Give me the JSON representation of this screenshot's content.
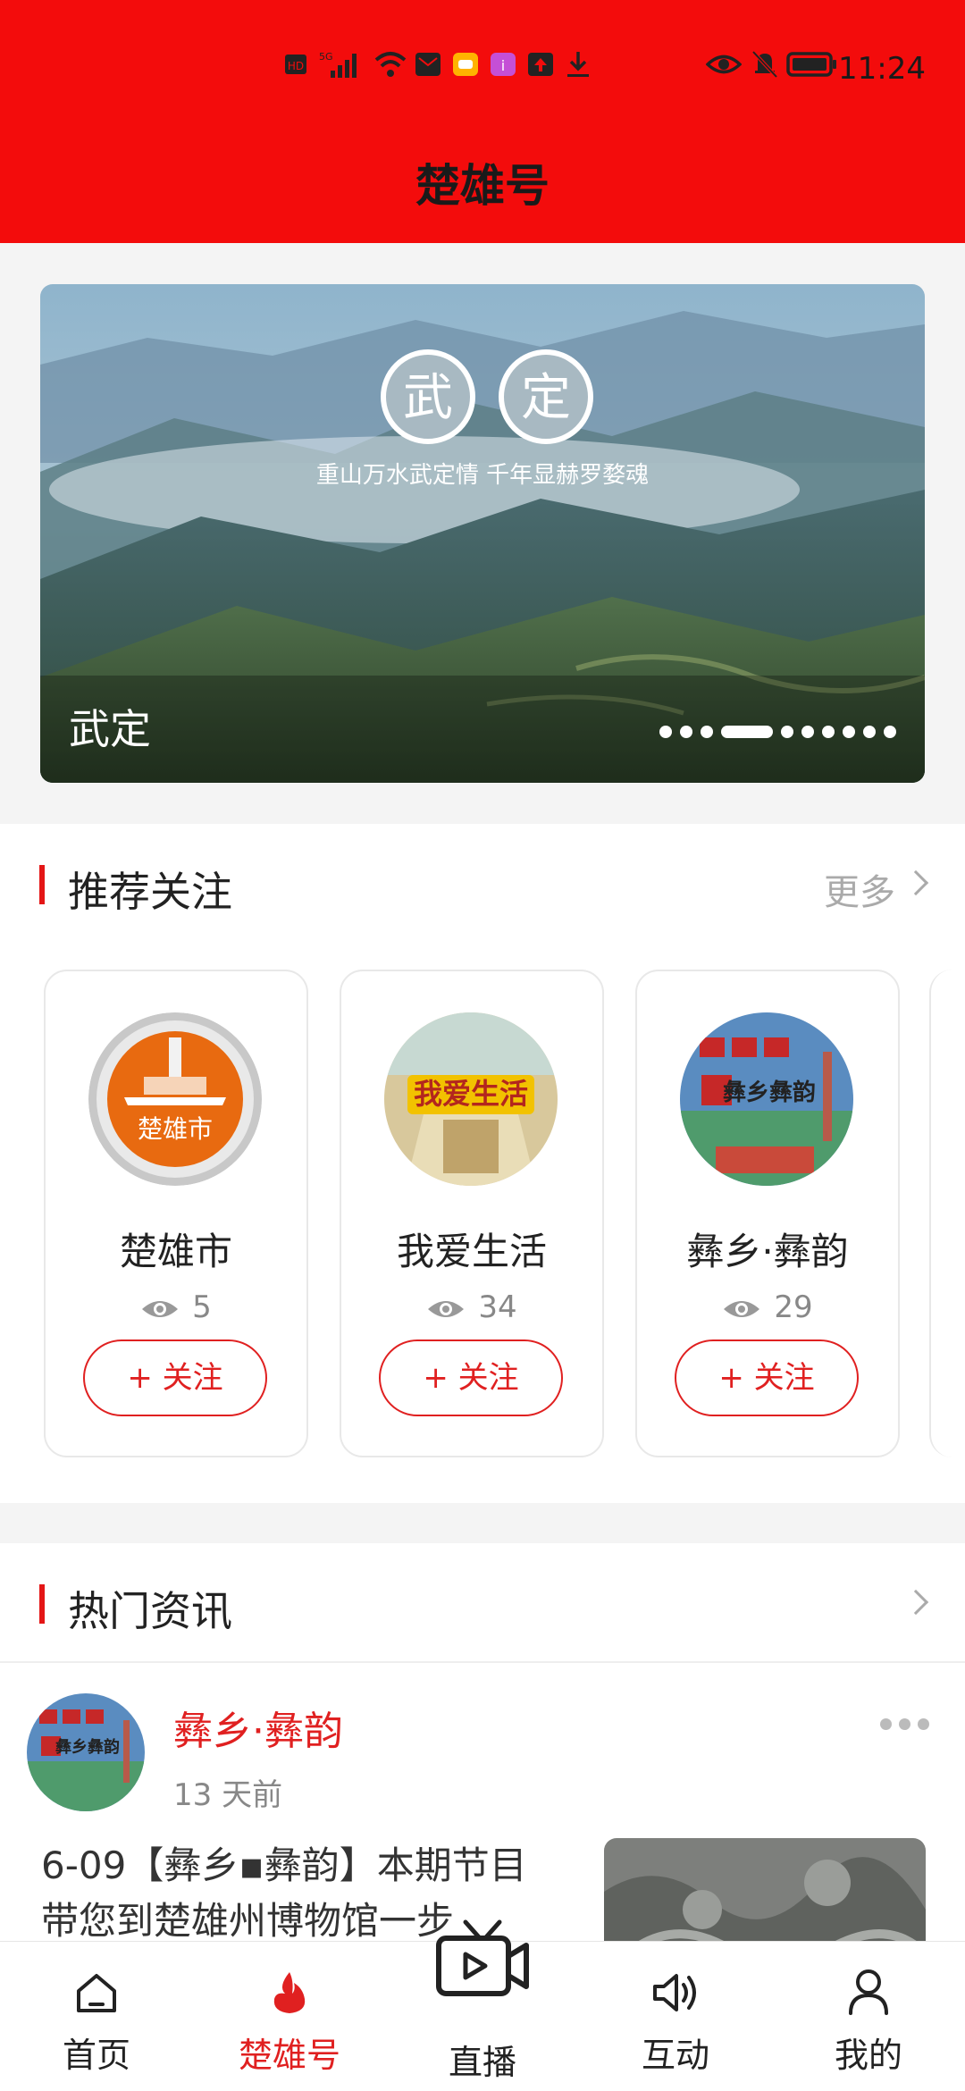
{
  "status_bar": {
    "left_badges": [
      "HD",
      "5G"
    ],
    "time": "11:24"
  },
  "header": {
    "title": "楚雄号"
  },
  "banner": {
    "seal_chars": [
      "武",
      "定"
    ],
    "slogan": "重山万水武定情 千年显赫罗婺魂",
    "caption": "武定",
    "pages": 10,
    "active_page": 3
  },
  "recommend": {
    "title": "推荐关注",
    "more_label": "更多",
    "cards": [
      {
        "name": "楚雄市",
        "views": "5",
        "follow_label": "+  关注",
        "avatar_text": "楚雄市"
      },
      {
        "name": "我爱生活",
        "views": "34",
        "follow_label": "+  关注",
        "avatar_text": "我爱生活"
      },
      {
        "name": "彝乡·彝韵",
        "views": "29",
        "follow_label": "+  关注",
        "avatar_text": "彝乡彝韵"
      }
    ]
  },
  "hot_news": {
    "title": "热门资讯",
    "item": {
      "source": "彝乡·彝韵",
      "time_ago": "13  天前",
      "text": "6-09【彝乡▪彝韵】本期节目带您到楚雄州博物馆一步",
      "avatar_text": "彝乡彝韵"
    }
  },
  "tabbar": {
    "tabs": [
      {
        "label": "首页",
        "icon": "home-icon"
      },
      {
        "label": "楚雄号",
        "icon": "flame-icon",
        "active": true
      },
      {
        "label": "直播",
        "icon": "tv-play-icon"
      },
      {
        "label": "互动",
        "icon": "speaker-icon"
      },
      {
        "label": "我的",
        "icon": "person-icon"
      }
    ]
  },
  "colors": {
    "brand_red": "#f30c0c",
    "accent_red": "#e02020"
  }
}
